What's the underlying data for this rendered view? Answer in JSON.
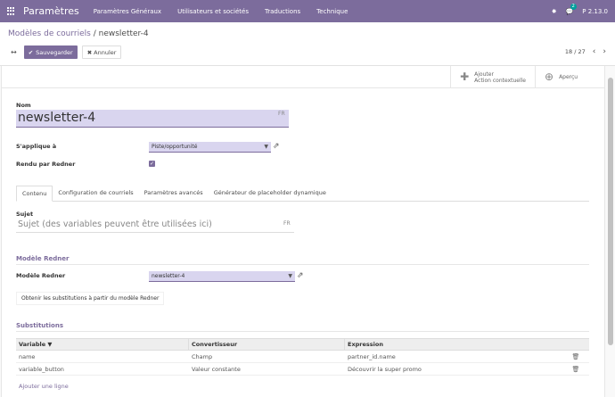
{
  "topbar": {
    "app_title": "Paramètres",
    "menu": [
      "Paramètres Généraux",
      "Utilisateurs et sociétés",
      "Traductions",
      "Technique"
    ],
    "chat_badge": "2",
    "version": "P 2.13.0"
  },
  "breadcrumb": {
    "parent": "Modèles de courriels",
    "separator": " / ",
    "current": "newsletter-4"
  },
  "controls": {
    "expand_icon": "↔",
    "save_label": "Sauvegarder",
    "discard_label": "Annuler",
    "pager": "18 / 27"
  },
  "button_box": {
    "add_action_line1": "Ajouter",
    "add_action_line2": "Action contextuelle",
    "preview_label": "Aperçu"
  },
  "form": {
    "name_label": "Nom",
    "name_value": "newsletter-4",
    "lang_tag": "FR",
    "applies_label": "S'applique à",
    "applies_value": "Piste/opportunité",
    "rendered_label": "Rendu par Redner",
    "rendered_checked": true
  },
  "tabs": [
    "Contenu",
    "Configuration de courriels",
    "Paramètres avancés",
    "Générateur de placeholder dynamique"
  ],
  "content": {
    "subject_label": "Sujet",
    "subject_placeholder": "Sujet (des variables peuvent être utilisées ici)",
    "subject_lang": "FR",
    "redner_section": "Modèle Redner",
    "redner_label": "Modèle Redner",
    "redner_value": "newsletter-4",
    "obtain_label": "Obtenir les substitutions à partir du modèle Redner",
    "subs_section": "Substitutions"
  },
  "table": {
    "headers": [
      "Variable ▼",
      "Convertisseur",
      "Expression"
    ],
    "rows": [
      {
        "variable": "name",
        "converter": "Champ",
        "expression": "partner_id.name"
      },
      {
        "variable": "variable_button",
        "converter": "Valeur constante",
        "expression": "Découvrir la super promo"
      }
    ],
    "add_line": "Ajouter une ligne"
  },
  "colors": {
    "brand": "#7c6c9c",
    "input_bg": "#d9d5ef"
  }
}
